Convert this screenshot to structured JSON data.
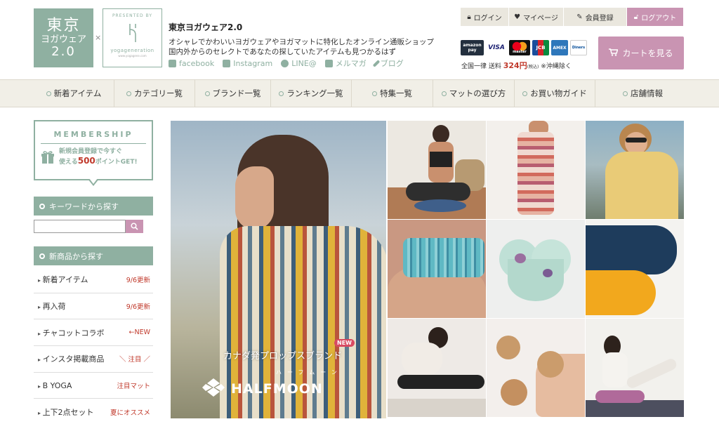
{
  "header": {
    "logo_line1": "東京",
    "logo_line2": "ヨガウェア",
    "logo_line3": "2.0",
    "logo_separator": "×",
    "presented_by": "PRESENTED BY",
    "presented_brand": "yogageneration",
    "presented_url": "www.yogagene.com",
    "site_name": "東京ヨガウェア2.0",
    "tagline_1": "オシャレでかわいいヨガウェアやヨガマットに特化したオンライン通販ショップ",
    "tagline_2": "国内外からのセレクトであなたの探していたアイテムも見つかるはず",
    "social": [
      {
        "label": "facebook",
        "icon": "facebook-icon"
      },
      {
        "label": "Instagram",
        "icon": "instagram-icon"
      },
      {
        "label": "LINE@",
        "icon": "line-icon"
      },
      {
        "label": "メルマガ",
        "icon": "mail-icon"
      },
      {
        "label": "ブログ",
        "icon": "pen-icon"
      }
    ],
    "topnav": [
      {
        "label": "ログイン",
        "icon": "lock-icon"
      },
      {
        "label": "マイページ",
        "icon": "heart-icon"
      },
      {
        "label": "会員登録",
        "icon": "pencil-icon"
      },
      {
        "label": "ログアウト",
        "icon": "unlock-icon"
      }
    ],
    "payments": [
      "amazon pay",
      "VISA",
      "master",
      "JCB",
      "AMEX",
      "Diners"
    ],
    "shipping_prefix": "全国一律 送料",
    "shipping_price": "324円",
    "shipping_tax": "(税込)",
    "shipping_suffix": "※沖縄除く",
    "cart_label": "カートを見る",
    "colors": {
      "accent": "#8fb0a1",
      "pink": "#c994b2",
      "nav_bg": "#f1efe7"
    }
  },
  "mainnav": [
    "新着アイテム",
    "カテゴリー覧",
    "ブランド一覧",
    "ランキング一覧",
    "特集一覧",
    "マットの選び方",
    "お買い物ガイド",
    "店舗情報"
  ],
  "sidebar": {
    "membership_title": "MEMBERSHIP",
    "membership_line1": "新規会員登録で今すぐ",
    "membership_line2a": "使える",
    "membership_points": "500",
    "membership_line2b": "ポイントGET!",
    "keyword_heading": "キーワードから探す",
    "search_placeholder": "",
    "new_heading": "新商品から探す",
    "items": [
      {
        "label": "新着アイテム",
        "note": "9/6更新"
      },
      {
        "label": "再入荷",
        "note": "9/6更新"
      },
      {
        "label": "チャコットコラボ",
        "note": "←NEW"
      },
      {
        "label": "インスタ掲載商品",
        "note": "＼ 注目 ／"
      },
      {
        "label": "B YOGA",
        "note": "注目マット"
      },
      {
        "label": "上下2点セット",
        "note": "夏にオススメ"
      }
    ]
  },
  "hero": {
    "brand_jp": "カナダ発プロップスブランド",
    "new_tag": "NEW",
    "kana": "ハーフムーン",
    "logo_word": "HALFMOON"
  }
}
